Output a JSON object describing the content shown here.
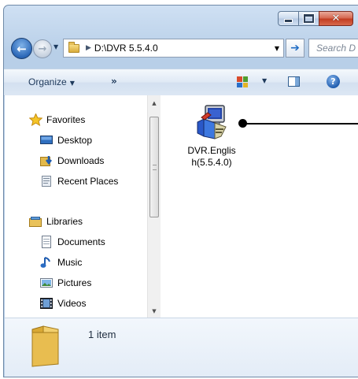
{
  "address": {
    "path": "D:\\DVR 5.5.4.0"
  },
  "search": {
    "placeholder": "Search D"
  },
  "toolbar": {
    "organize_label": "Organize",
    "more_label": "»"
  },
  "navigation": {
    "favorites": {
      "label": "Favorites",
      "items": [
        "Desktop",
        "Downloads",
        "Recent Places"
      ]
    },
    "libraries": {
      "label": "Libraries",
      "items": [
        "Documents",
        "Music",
        "Pictures",
        "Videos"
      ]
    }
  },
  "files": [
    {
      "name_line1": "DVR.Englis",
      "name_line2": "h(5.5.4.0)"
    }
  ],
  "details": {
    "item_count": "1 item"
  },
  "colors": {
    "accent": "#2c68b8",
    "titlebar": "#b8cfe8",
    "close": "#c23d22"
  }
}
